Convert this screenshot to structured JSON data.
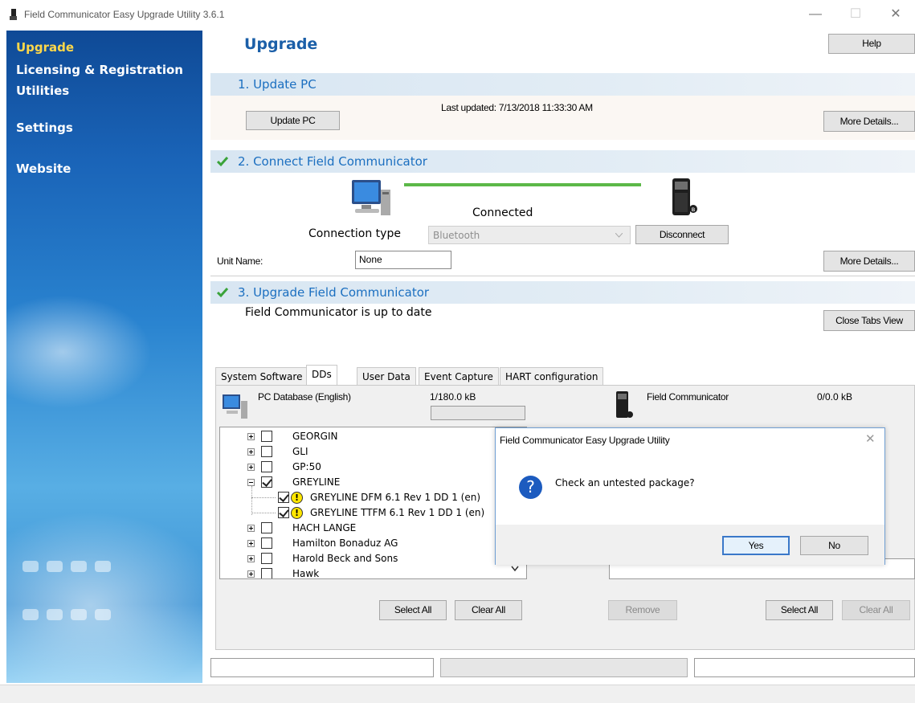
{
  "window": {
    "title": "Field Communicator Easy Upgrade Utility 3.6.1",
    "minimize": "—",
    "maximize": "☐",
    "close": "✕"
  },
  "sidebar": {
    "items": [
      {
        "label": "Upgrade",
        "active": true
      },
      {
        "label": "Licensing & Registration",
        "active": false
      },
      {
        "label": "Utilities",
        "active": false
      },
      {
        "label": "Settings",
        "active": false
      },
      {
        "label": "Website",
        "active": false
      }
    ]
  },
  "header": {
    "title": "Upgrade",
    "help_label": "Help"
  },
  "section1": {
    "title": "1. Update PC",
    "update_label": "Update PC",
    "last_updated": "Last updated: 7/13/2018 11:33:30 AM",
    "more_details": "More Details..."
  },
  "section2": {
    "title": "2. Connect Field Communicator",
    "status": "Connected",
    "connection_type_label": "Connection type",
    "connection_type_value": "Bluetooth",
    "disconnect_label": "Disconnect",
    "unit_name_label": "Unit Name:",
    "unit_name_value": "None",
    "more_details": "More Details..."
  },
  "section3": {
    "title": "3. Upgrade Field Communicator",
    "status": "Field Communicator is up to date",
    "close_tabs_label": "Close Tabs View"
  },
  "tabs": [
    {
      "label": "System Software"
    },
    {
      "label": "DDs",
      "active": true
    },
    {
      "label": "User Data"
    },
    {
      "label": "Event Capture"
    },
    {
      "label": "HART configuration"
    }
  ],
  "pc_db": {
    "label": "PC Database (English)",
    "size": "1/180.0 kB"
  },
  "fc_db": {
    "label": "Field Communicator",
    "size": "0/0.0 kB"
  },
  "tree": [
    {
      "label": "GEORGIN",
      "expand": "plus",
      "checked": false
    },
    {
      "label": "GLI",
      "expand": "plus",
      "checked": false
    },
    {
      "label": "GP:50",
      "expand": "plus",
      "checked": false
    },
    {
      "label": "GREYLINE",
      "expand": "minus",
      "checked": true
    },
    {
      "label": "GREYLINE DFM 6.1 Rev 1 DD 1 (en)",
      "child": true,
      "checked": true,
      "warn": "!"
    },
    {
      "label": "GREYLINE TTFM 6.1 Rev 1 DD 1 (en)",
      "child": true,
      "checked": true,
      "warn": "!"
    },
    {
      "label": "HACH LANGE",
      "expand": "plus",
      "checked": false
    },
    {
      "label": "Hamilton Bonaduz AG",
      "expand": "plus",
      "checked": false
    },
    {
      "label": "Harold Beck and Sons",
      "expand": "plus",
      "checked": false
    },
    {
      "label": "Hawk",
      "expand": "plus",
      "checked": false
    }
  ],
  "buttons": {
    "select_all": "Select All",
    "clear_all": "Clear All",
    "remove": "Remove"
  },
  "dialog": {
    "title": "Field Communicator Easy Upgrade Utility",
    "close": "✕",
    "question_icon": "?",
    "message": "Check an untested package?",
    "yes": "Yes",
    "no": "No"
  },
  "colors": {
    "accent": "#1b5fa8",
    "section_text": "#1b6fc0",
    "active_nav": "#ffd84a",
    "progress": "#5cb848",
    "dialog_border": "#6f9ed3"
  }
}
